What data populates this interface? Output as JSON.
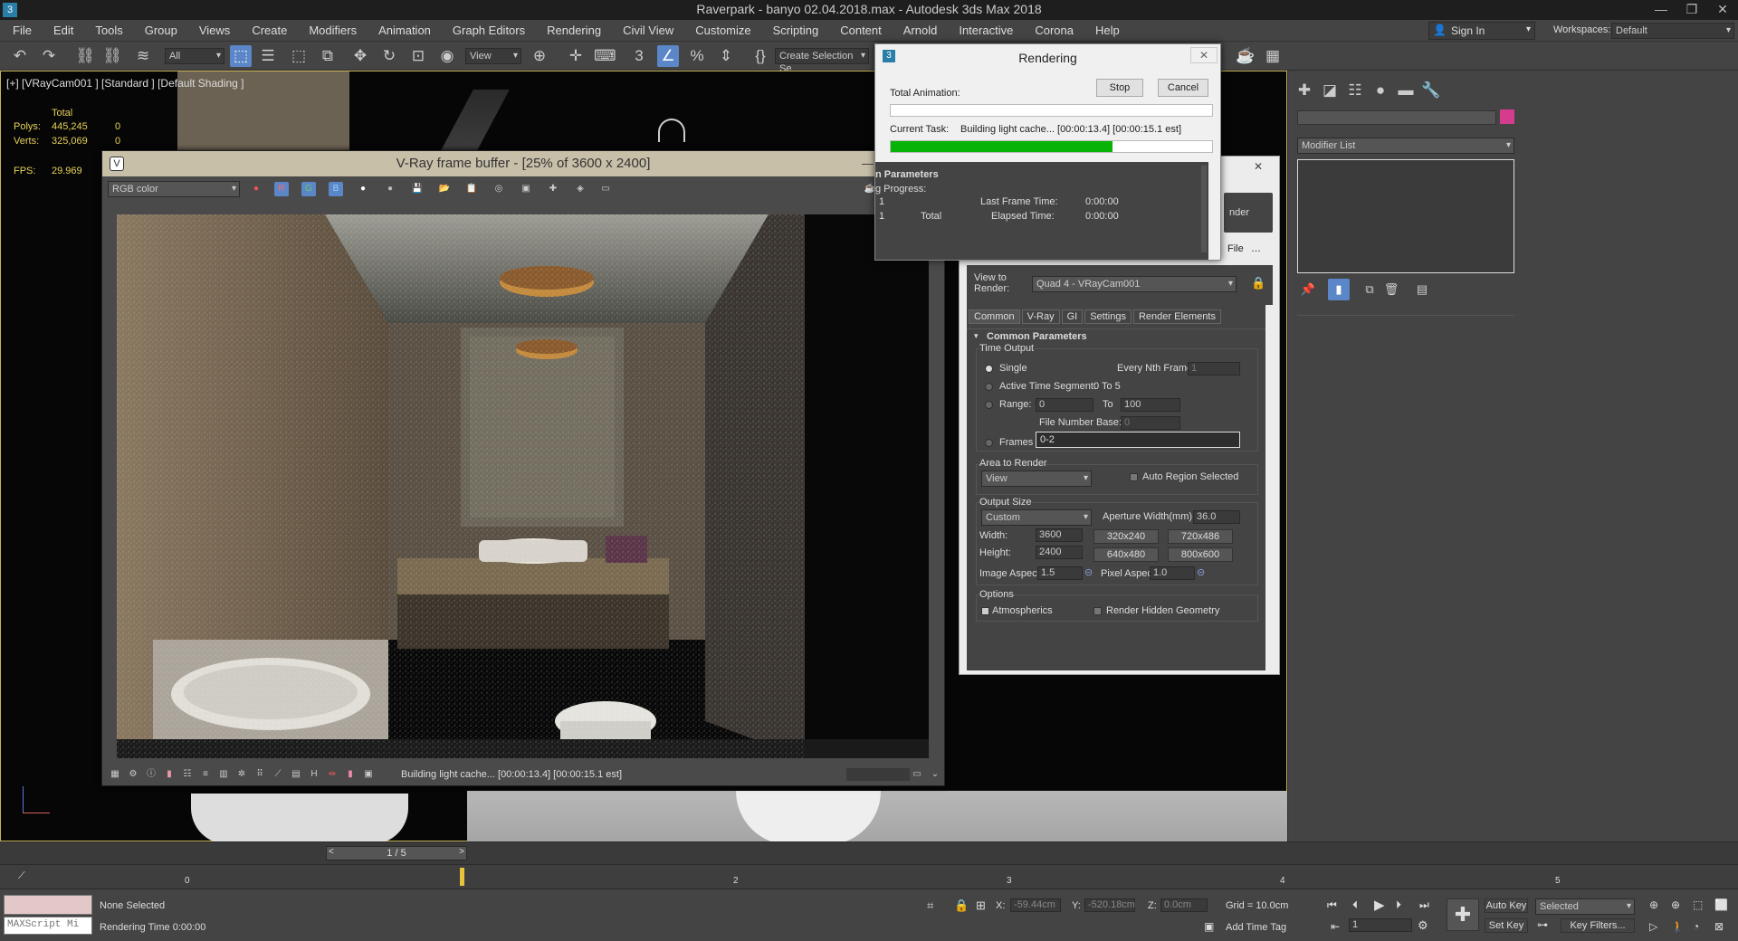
{
  "app": {
    "title": "Raverpark - banyo 02.04.2018.max - Autodesk 3ds Max 2018",
    "app_icon": "3"
  },
  "menu": [
    "File",
    "Edit",
    "Tools",
    "Group",
    "Views",
    "Create",
    "Modifiers",
    "Animation",
    "Graph Editors",
    "Rendering",
    "Civil View",
    "Customize",
    "Scripting",
    "Content",
    "Arnold",
    "Interactive",
    "Corona",
    "Help"
  ],
  "account": {
    "sign_in": "Sign In",
    "workspaces_label": "Workspaces:",
    "workspace": "Default"
  },
  "toolbar": {
    "filter": "All",
    "view": "View",
    "selection_set": "Create Selection Se"
  },
  "viewport": {
    "label": "[+] [VRayCam001 ] [Standard ] [Default Shading ]",
    "stats_header": "Total",
    "polys_label": "Polys:",
    "polys": "445,245",
    "polys_sel": "0",
    "verts_label": "Verts:",
    "verts": "325,069",
    "verts_sel": "0",
    "fps_label": "FPS:",
    "fps": "29.969"
  },
  "vfb": {
    "title": "V-Ray frame buffer - [25% of 3600 x 2400]",
    "channel": "RGB color",
    "status": "Building light cache... [00:00:13.4] [00:00:15.1 est]"
  },
  "rendering_dialog": {
    "title": "Rendering",
    "stop": "Stop",
    "cancel": "Cancel",
    "total_animation": "Total Animation:",
    "current_task_label": "Current Task:",
    "current_task": "Building light cache... [00:00:13.4] [00:00:15.1 est]",
    "current_progress": 0.69,
    "section": "n Parameters",
    "rendering_progress": "g Progress:",
    "frame_value": "1",
    "total_value": "1",
    "total_label": "Total",
    "last_frame_time_label": "Last Frame Time:",
    "last_frame_time": "0:00:00",
    "elapsed_time_label": "Elapsed Time:",
    "elapsed_time": "0:00:00"
  },
  "render_setup": {
    "render_btn": "nder",
    "file_label": "File",
    "view_to_render_label": "View to Render:",
    "view_to_render": "Quad 4 - VRayCam001",
    "tabs": [
      "Common",
      "V-Ray",
      "GI",
      "Settings",
      "Render Elements"
    ],
    "rollout": "Common Parameters",
    "time_output": "Time Output",
    "single": "Single",
    "every_nth_label": "Every Nth Frame:",
    "every_nth": "1",
    "active_segment_label": "Active Time Segment:",
    "active_segment": "0 To 5",
    "range_label": "Range:",
    "range_from": "0",
    "to_label": "To",
    "range_to": "100",
    "file_number_base_label": "File Number Base:",
    "file_number_base": "0",
    "frames_label": "Frames",
    "frames": "0-2",
    "area_to_render": "Area to Render",
    "area": "View",
    "auto_region": "Auto Region Selected",
    "output_size": "Output Size",
    "size_preset": "Custom",
    "aperture_label": "Aperture Width(mm):",
    "aperture": "36.0",
    "width_label": "Width:",
    "width": "3600",
    "height_label": "Height:",
    "height": "2400",
    "presets": [
      "320x240",
      "720x486",
      "640x480",
      "800x600"
    ],
    "image_aspect_label": "Image Aspect:",
    "image_aspect": "1.5",
    "pixel_aspect_label": "Pixel Aspect:",
    "pixel_aspect": "1.0",
    "options": "Options",
    "atmospherics": "Atmospherics",
    "render_hidden": "Render Hidden Geometry"
  },
  "command_panel": {
    "modifier_list": "Modifier List",
    "swatch_color": "#d63c8e"
  },
  "timeline": {
    "frame_counter": "1 / 5",
    "ticks": [
      "0",
      "2",
      "3",
      "4",
      "5"
    ],
    "tick_1": "1"
  },
  "status": {
    "none_selected": "None Selected",
    "rendering_time": "Rendering Time  0:00:00",
    "maxscript": "MAXScript Mi",
    "x_label": "X:",
    "x": "-59.44cm",
    "y_label": "Y:",
    "y": "-520.18cm",
    "z_label": "Z:",
    "z": "0.0cm",
    "grid": "Grid = 10.0cm",
    "add_time_tag": "Add Time Tag",
    "auto_key": "Auto Key",
    "set_key": "Set Key",
    "selected": "Selected",
    "key_filters": "Key Filters...",
    "frame": "1"
  }
}
